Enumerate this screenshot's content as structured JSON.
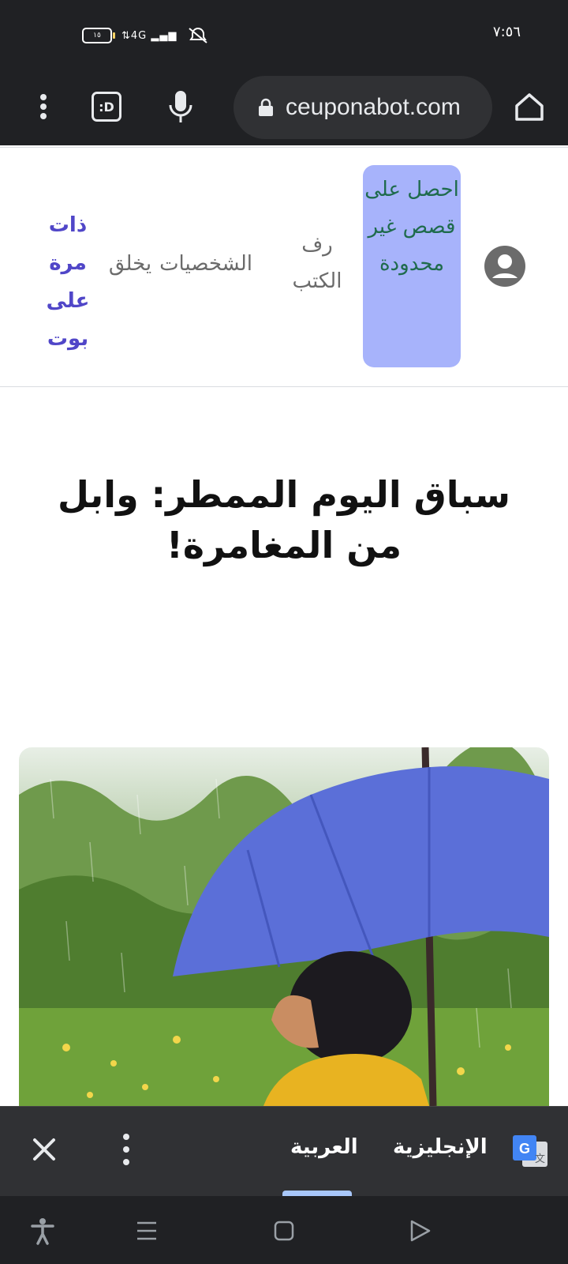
{
  "status_bar": {
    "battery_level": "١٥",
    "network": "4G",
    "time": "٧:٥٦"
  },
  "browser": {
    "url": "ceuponabot.com",
    "tab_switcher_label": ":D",
    "icons": [
      "more-vert-icon",
      "tab-switcher-icon",
      "mic-icon",
      "lock-icon",
      "home-icon"
    ]
  },
  "site_nav": {
    "cta_label": "احصل على قصص غير محدودة",
    "bookshelf_label": "رف الكتب",
    "characters_label": "الشخصيات",
    "create_label": "يخلق",
    "brand_top": "ذات مرة",
    "brand_bottom": "على بوت"
  },
  "story": {
    "title": "سباق اليوم الممطر: وابل من المغامرة!"
  },
  "translate_bar": {
    "source_language": "العربية",
    "target_language": "الإنجليزية",
    "active_language": "source"
  },
  "colors": {
    "chrome_dark": "#202124",
    "omnibox": "#303134",
    "cta_background": "#a7b3fb",
    "cta_text": "#1f6b4d",
    "brand": "#5046c8",
    "translate_underline": "#a8c7fa"
  }
}
